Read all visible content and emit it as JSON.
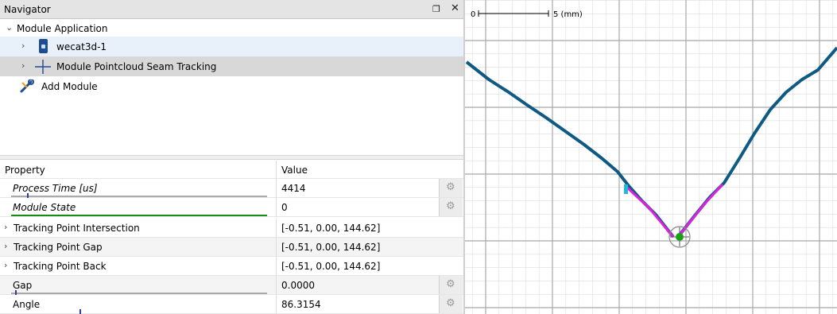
{
  "navigator": {
    "title": "Navigator",
    "float_icon": "float-window-icon",
    "close_icon": "close-icon",
    "items": [
      {
        "label": "Module Application",
        "icon": "chevron-down-icon"
      },
      {
        "label": "wecat3d-1",
        "icon": "sensor-device-icon"
      },
      {
        "label": "Module Pointcloud Seam Tracking",
        "icon": "crosshair-icon"
      },
      {
        "label": "Add Module",
        "icon": "wrench-screwdriver-icon"
      }
    ]
  },
  "properties": {
    "header": {
      "name": "Property",
      "value": "Value"
    },
    "rows": [
      {
        "name": "Process Time [us]",
        "value": "4414"
      },
      {
        "name": "Module State",
        "value": "0"
      },
      {
        "name": "Tracking Point Intersection",
        "value": "[-0.51, 0.00, 144.62]"
      },
      {
        "name": "Tracking Point Gap",
        "value": "[-0.51, 0.00, 144.62]"
      },
      {
        "name": "Tracking Point Back",
        "value": "[-0.51, 0.00, 144.62]"
      },
      {
        "name": "Gap",
        "value": "0.0000"
      },
      {
        "name": "Angle",
        "value": "86.3154"
      }
    ]
  },
  "plot": {
    "scale_start": "0",
    "scale_end": "5 (mm)",
    "colors": {
      "profile": "#0e5a82",
      "fit": "#e020e0",
      "point": "#18a018",
      "grid": "#b8b8b8"
    }
  }
}
